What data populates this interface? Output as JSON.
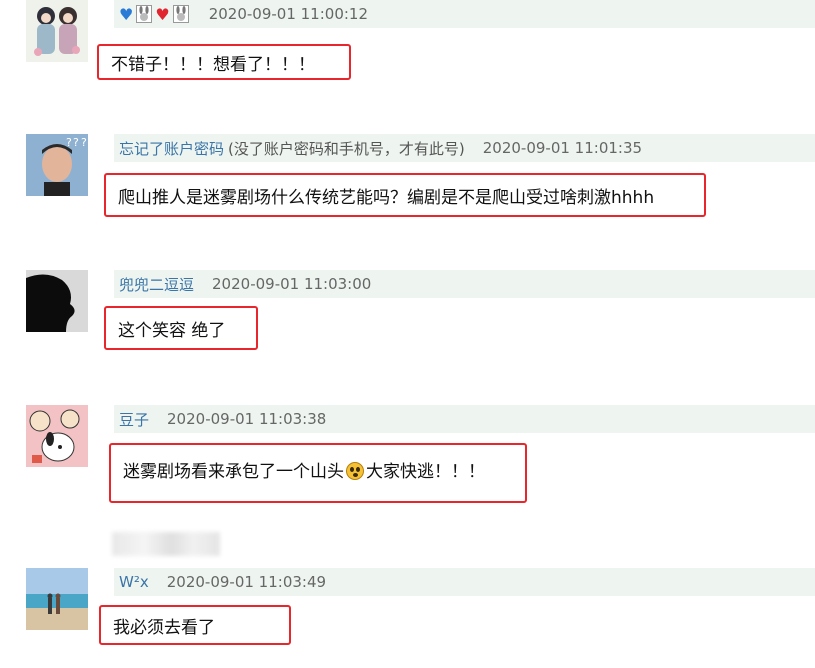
{
  "comments": [
    {
      "username": "",
      "badge": [
        "blue-heart",
        "bunny",
        "red-heart",
        "bunny"
      ],
      "time": "2020-09-01 11:00:12",
      "text": "不错子！！！想看了！！！"
    },
    {
      "username": "忘记了账户密码",
      "note": "(没了账户密码和手机号，才有此号)",
      "time": "2020-09-01 11:01:35",
      "text": "爬山推人是迷雾剧场什么传统艺能吗？编剧是不是爬山受过啥刺激hhhh"
    },
    {
      "username": "兜兜二逗逗",
      "time": "2020-09-01 11:03:00",
      "text": "这个笑容 绝了"
    },
    {
      "username": "豆子",
      "time": "2020-09-01 11:03:38",
      "text_before": "迷雾剧场看来承包了一个山头",
      "emoji": "surprised-face-icon",
      "text_after": "大家快逃！！！"
    },
    {
      "username": "W²x",
      "time": "2020-09-01 11:03:49",
      "text": "我必须去看了"
    }
  ],
  "colors": {
    "highlight_border": "#e8262b",
    "meta_bar_bg": "#eef5f0",
    "username": "#3a74a8"
  }
}
